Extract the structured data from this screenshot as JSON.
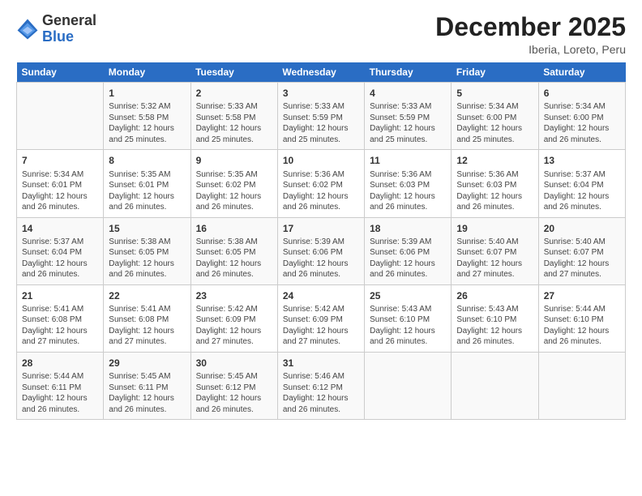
{
  "logo": {
    "general": "General",
    "blue": "Blue"
  },
  "header": {
    "month_year": "December 2025",
    "location": "Iberia, Loreto, Peru"
  },
  "days_of_week": [
    "Sunday",
    "Monday",
    "Tuesday",
    "Wednesday",
    "Thursday",
    "Friday",
    "Saturday"
  ],
  "weeks": [
    [
      {
        "day": "",
        "info": ""
      },
      {
        "day": "1",
        "info": "Sunrise: 5:32 AM\nSunset: 5:58 PM\nDaylight: 12 hours\nand 25 minutes."
      },
      {
        "day": "2",
        "info": "Sunrise: 5:33 AM\nSunset: 5:58 PM\nDaylight: 12 hours\nand 25 minutes."
      },
      {
        "day": "3",
        "info": "Sunrise: 5:33 AM\nSunset: 5:59 PM\nDaylight: 12 hours\nand 25 minutes."
      },
      {
        "day": "4",
        "info": "Sunrise: 5:33 AM\nSunset: 5:59 PM\nDaylight: 12 hours\nand 25 minutes."
      },
      {
        "day": "5",
        "info": "Sunrise: 5:34 AM\nSunset: 6:00 PM\nDaylight: 12 hours\nand 25 minutes."
      },
      {
        "day": "6",
        "info": "Sunrise: 5:34 AM\nSunset: 6:00 PM\nDaylight: 12 hours\nand 26 minutes."
      }
    ],
    [
      {
        "day": "7",
        "info": "Sunrise: 5:34 AM\nSunset: 6:01 PM\nDaylight: 12 hours\nand 26 minutes."
      },
      {
        "day": "8",
        "info": "Sunrise: 5:35 AM\nSunset: 6:01 PM\nDaylight: 12 hours\nand 26 minutes."
      },
      {
        "day": "9",
        "info": "Sunrise: 5:35 AM\nSunset: 6:02 PM\nDaylight: 12 hours\nand 26 minutes."
      },
      {
        "day": "10",
        "info": "Sunrise: 5:36 AM\nSunset: 6:02 PM\nDaylight: 12 hours\nand 26 minutes."
      },
      {
        "day": "11",
        "info": "Sunrise: 5:36 AM\nSunset: 6:03 PM\nDaylight: 12 hours\nand 26 minutes."
      },
      {
        "day": "12",
        "info": "Sunrise: 5:36 AM\nSunset: 6:03 PM\nDaylight: 12 hours\nand 26 minutes."
      },
      {
        "day": "13",
        "info": "Sunrise: 5:37 AM\nSunset: 6:04 PM\nDaylight: 12 hours\nand 26 minutes."
      }
    ],
    [
      {
        "day": "14",
        "info": "Sunrise: 5:37 AM\nSunset: 6:04 PM\nDaylight: 12 hours\nand 26 minutes."
      },
      {
        "day": "15",
        "info": "Sunrise: 5:38 AM\nSunset: 6:05 PM\nDaylight: 12 hours\nand 26 minutes."
      },
      {
        "day": "16",
        "info": "Sunrise: 5:38 AM\nSunset: 6:05 PM\nDaylight: 12 hours\nand 26 minutes."
      },
      {
        "day": "17",
        "info": "Sunrise: 5:39 AM\nSunset: 6:06 PM\nDaylight: 12 hours\nand 26 minutes."
      },
      {
        "day": "18",
        "info": "Sunrise: 5:39 AM\nSunset: 6:06 PM\nDaylight: 12 hours\nand 26 minutes."
      },
      {
        "day": "19",
        "info": "Sunrise: 5:40 AM\nSunset: 6:07 PM\nDaylight: 12 hours\nand 27 minutes."
      },
      {
        "day": "20",
        "info": "Sunrise: 5:40 AM\nSunset: 6:07 PM\nDaylight: 12 hours\nand 27 minutes."
      }
    ],
    [
      {
        "day": "21",
        "info": "Sunrise: 5:41 AM\nSunset: 6:08 PM\nDaylight: 12 hours\nand 27 minutes."
      },
      {
        "day": "22",
        "info": "Sunrise: 5:41 AM\nSunset: 6:08 PM\nDaylight: 12 hours\nand 27 minutes."
      },
      {
        "day": "23",
        "info": "Sunrise: 5:42 AM\nSunset: 6:09 PM\nDaylight: 12 hours\nand 27 minutes."
      },
      {
        "day": "24",
        "info": "Sunrise: 5:42 AM\nSunset: 6:09 PM\nDaylight: 12 hours\nand 27 minutes."
      },
      {
        "day": "25",
        "info": "Sunrise: 5:43 AM\nSunset: 6:10 PM\nDaylight: 12 hours\nand 26 minutes."
      },
      {
        "day": "26",
        "info": "Sunrise: 5:43 AM\nSunset: 6:10 PM\nDaylight: 12 hours\nand 26 minutes."
      },
      {
        "day": "27",
        "info": "Sunrise: 5:44 AM\nSunset: 6:10 PM\nDaylight: 12 hours\nand 26 minutes."
      }
    ],
    [
      {
        "day": "28",
        "info": "Sunrise: 5:44 AM\nSunset: 6:11 PM\nDaylight: 12 hours\nand 26 minutes."
      },
      {
        "day": "29",
        "info": "Sunrise: 5:45 AM\nSunset: 6:11 PM\nDaylight: 12 hours\nand 26 minutes."
      },
      {
        "day": "30",
        "info": "Sunrise: 5:45 AM\nSunset: 6:12 PM\nDaylight: 12 hours\nand 26 minutes."
      },
      {
        "day": "31",
        "info": "Sunrise: 5:46 AM\nSunset: 6:12 PM\nDaylight: 12 hours\nand 26 minutes."
      },
      {
        "day": "",
        "info": ""
      },
      {
        "day": "",
        "info": ""
      },
      {
        "day": "",
        "info": ""
      }
    ]
  ]
}
